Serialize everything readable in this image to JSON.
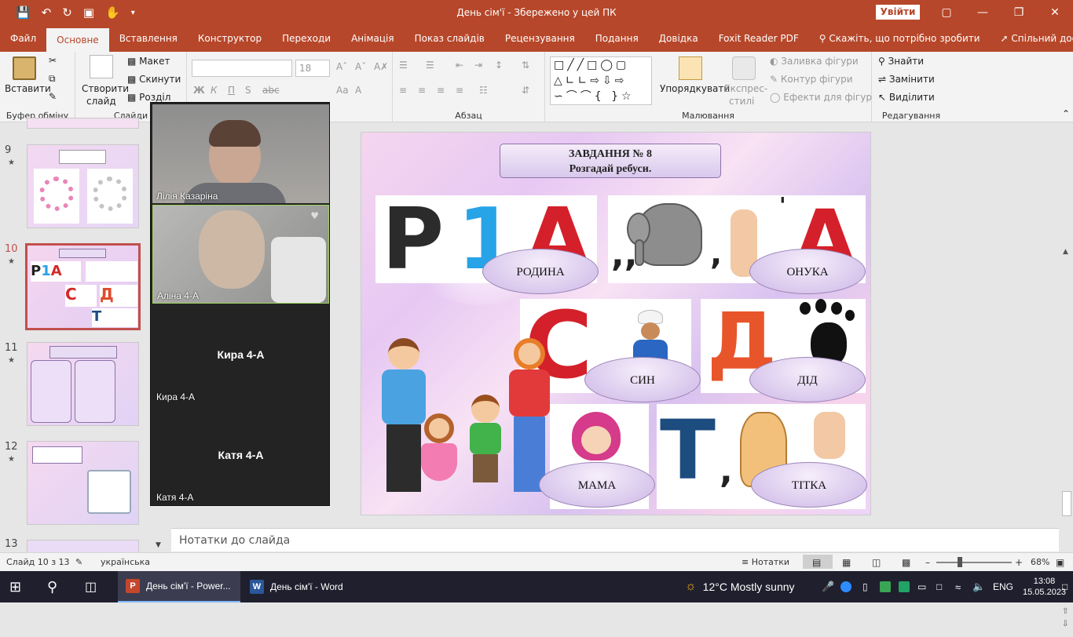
{
  "window": {
    "title": "День сім'ї  -  Збережено у цей ПК",
    "signin_label": "Увійти"
  },
  "ribbon_tabs": [
    "Файл",
    "Основне",
    "Вставлення",
    "Конструктор",
    "Переходи",
    "Анімація",
    "Показ слайдів",
    "Рецензування",
    "Подання",
    "Довідка",
    "Foxit Reader PDF"
  ],
  "tell_me": "Скажіть, що потрібно зробити",
  "share_label": "Спільний доступ",
  "ribbon": {
    "paste": "Вставити",
    "clipboard_group": "Буфер обміну",
    "new_slide_1": "Створити",
    "new_slide_2": "слайд",
    "layout": "Макет",
    "reset": "Скинути",
    "section": "Розділ",
    "slides_group": "Слайди",
    "font_size": "18",
    "bold": "Ж",
    "italic": "К",
    "underline": "П",
    "strike": "S",
    "spacing": "abc",
    "paragraph_group": "Абзац",
    "arrange": "Упорядкувати",
    "quick_styles_1": "Експрес-",
    "quick_styles_2": "стилі",
    "shape_fill": "Заливка фігури",
    "shape_outline": "Контур фігури",
    "shape_effects": "Ефекти для фігур",
    "drawing_group": "Малювання",
    "find": "Знайти",
    "replace": "Замінити",
    "select": "Виділити",
    "editing_group": "Редагування"
  },
  "thumbnails": [
    {
      "num": "9"
    },
    {
      "num": "10"
    },
    {
      "num": "11"
    },
    {
      "num": "12"
    },
    {
      "num": "13"
    }
  ],
  "video_tiles": [
    {
      "name": "Лілія Казаріна",
      "center": ""
    },
    {
      "name": "Аліна 4-А",
      "center": ""
    },
    {
      "name": "Кира 4-А",
      "center": "Кира 4-А"
    },
    {
      "name": "Катя  4-А",
      "center": "Катя  4-А"
    }
  ],
  "slide": {
    "task_title": "ЗАВДАННЯ № 8",
    "task_subtitle": "Розгадай ребуси.",
    "answers": [
      "РОДИНА",
      "ОНУКА",
      "СИН",
      "ДІД",
      "МАМА",
      "ТІТКА"
    ],
    "rebus_glyphs": [
      "Р",
      "1",
      "А",
      ",,",
      ",",
      "'",
      "А",
      "С",
      "Д",
      "Т",
      ","
    ]
  },
  "notes_placeholder": "Нотатки до слайда",
  "status": {
    "slide_counter": "Слайд 10 з 13",
    "language": "українська",
    "notes_button": "Нотатки",
    "zoom": "68%"
  },
  "taskbar": {
    "ppt_label": "День сім'ї - Power...",
    "word_label": "День сім'ї - Word",
    "weather": "12°C  Mostly sunny",
    "input_lang": "ENG",
    "time": "13:08",
    "date": "15.05.2023"
  },
  "colors": {
    "accent": "#b7472a",
    "selected_thumb": "#c0504d",
    "oval_border": "#9b84b8"
  }
}
